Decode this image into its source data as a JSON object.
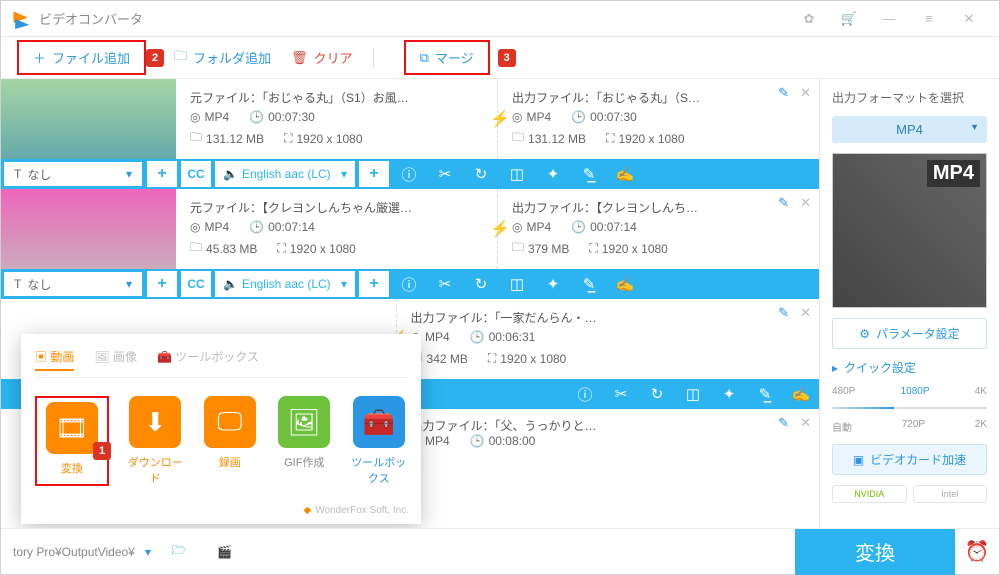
{
  "app": {
    "title": "ビデオコンバータ"
  },
  "toolbar": {
    "add_file": "ファイル追加",
    "add_folder": "フォルダ追加",
    "clear": "クリア",
    "merge": "マージ"
  },
  "badges": {
    "b1": "1",
    "b2": "2",
    "b3": "3"
  },
  "files": [
    {
      "src_label": "元ファイル：",
      "src_name": "「おじゃる丸」（S1）お風…",
      "out_label": "出力ファイル：",
      "out_name": "「おじゃる丸」（S…",
      "format": "MP4",
      "duration": "00:07:30",
      "src_size": "131.12 MB",
      "out_size": "131.12 MB",
      "resolution": "1920 x 1080",
      "subtitle": "なし",
      "audio": "English aac (LC)"
    },
    {
      "src_label": "元ファイル：",
      "src_name": "【クレヨンしんちゃん厳選…",
      "out_label": "出力ファイル：",
      "out_name": "【クレヨンしんち…",
      "format": "MP4",
      "duration": "00:07:14",
      "src_size": "45.83 MB",
      "out_size": "379 MB",
      "resolution": "1920 x 1080",
      "subtitle": "なし",
      "audio": "English aac (LC)"
    },
    {
      "out_label": "出力ファイル：",
      "out_name": "「一家だんらん・…",
      "format": "MP4",
      "duration": "00:06:31",
      "out_size": "342 MB",
      "resolution": "1920 x 1080"
    },
    {
      "out_label": "出力ファイル：",
      "out_name": "「父、うっかりと…",
      "format": "MP4",
      "duration": "00:08:00"
    }
  ],
  "sidebar": {
    "select_format": "出力フォーマットを選択",
    "format": "MP4",
    "preview_text": "MP4",
    "param": "パラメータ設定",
    "quick": "クイック設定",
    "q": {
      "p480": "480P",
      "p720": "720P",
      "p1080": "1080P",
      "k2": "2K",
      "k4": "4K",
      "auto": "自動"
    },
    "hw": "ビデオカード加速",
    "nvidia": "NVIDIA",
    "intel": "Intel"
  },
  "popup": {
    "tab_video": "動画",
    "tab_image": "画像",
    "tab_tools": "ツールボックス",
    "tiles": {
      "convert": "変換",
      "download": "ダウンロード",
      "record": "録画",
      "gif": "GIF作成",
      "tools": "ツールボックス"
    },
    "footer": "WonderFox Soft, Inc."
  },
  "bottombar": {
    "path": "tory Pro¥OutputVideo¥",
    "convert": "変換"
  }
}
